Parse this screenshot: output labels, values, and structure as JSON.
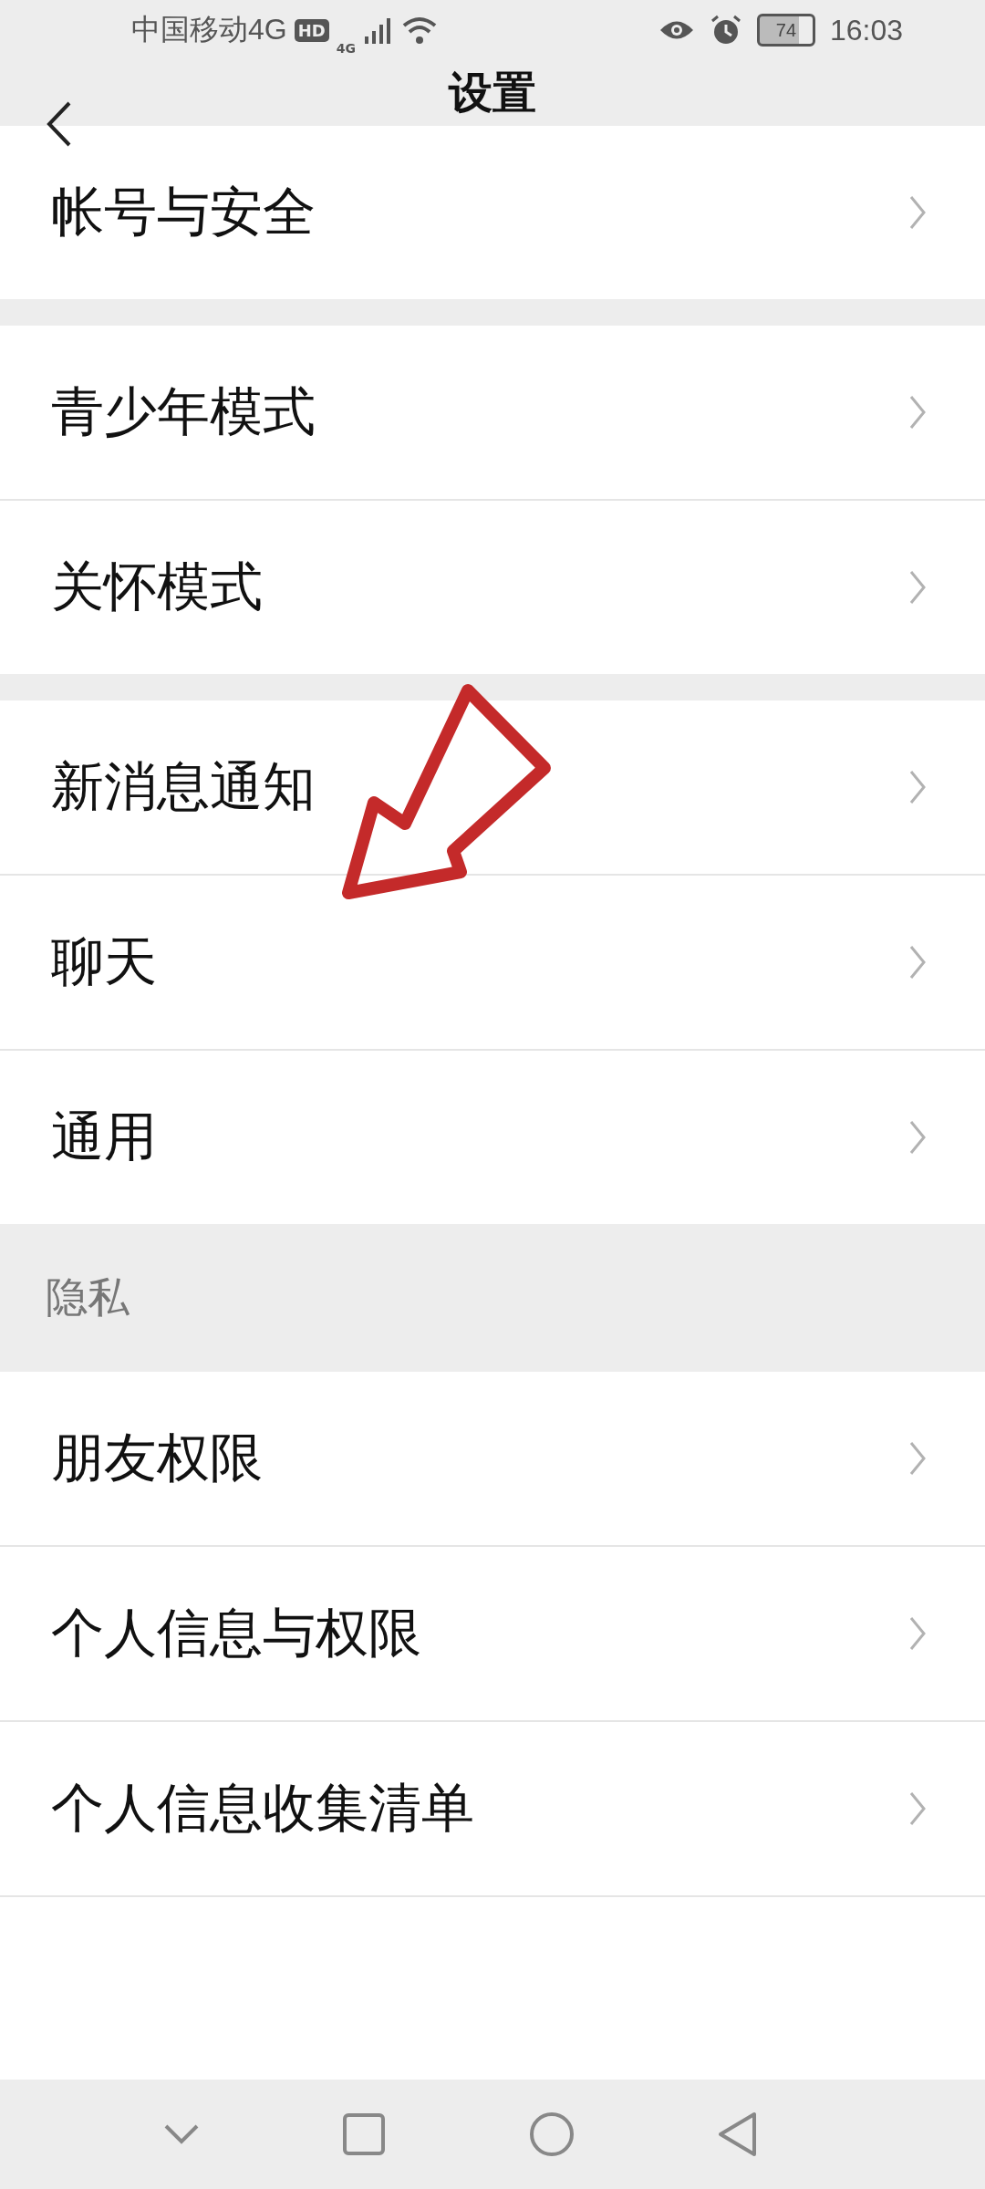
{
  "status_bar": {
    "carrier": "中国移动4G",
    "hd": "HD",
    "network": "4G",
    "battery": "74",
    "time": "16:03"
  },
  "header": {
    "title": "设置"
  },
  "groups": [
    {
      "items": [
        {
          "label": "帐号与安全"
        }
      ]
    },
    {
      "items": [
        {
          "label": "青少年模式"
        },
        {
          "label": "关怀模式"
        }
      ]
    },
    {
      "items": [
        {
          "label": "新消息通知"
        },
        {
          "label": "聊天"
        },
        {
          "label": "通用"
        }
      ]
    },
    {
      "title": "隐私",
      "items": [
        {
          "label": "朋友权限"
        },
        {
          "label": "个人信息与权限"
        },
        {
          "label": "个人信息收集清单"
        }
      ]
    }
  ],
  "annotation": {
    "kind": "arrow"
  }
}
